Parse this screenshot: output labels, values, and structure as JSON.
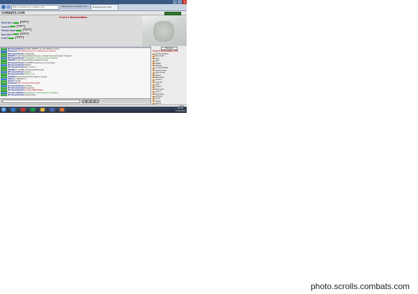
{
  "browser": {
    "address": "http://capitalcity.combats.com/",
    "tabs": [
      "http://www.combats.com",
      "Бойцовский клуб"
    ]
  },
  "game": {
    "logo": "COMBATS.COM",
    "battle_title": "Стуга в Катакомбах",
    "fighters": [
      {
        "name": "Black Eyes",
        "action": "Выйти"
      },
      {
        "name": "Ancient",
        "action": "Выйти"
      },
      {
        "name": "Черная миша",
        "action": "Выйти"
      },
      {
        "name": "Dark Spirit",
        "action": "Выйти"
      },
      {
        "name": "mmmf",
        "action": "Выйти"
      }
    ],
    "chat": [
      {
        "time": "23:21",
        "sender": "[Истинный Воин]",
        "text": "private [ SMARF ] по хил забегаю позже",
        "style": "plain"
      },
      {
        "time": "23:21",
        "sender": "Внимание!",
        "text": "Приведение пресса требование в лечении",
        "style": "red"
      },
      {
        "time": "23:21",
        "sender": "[Истинный Воин]",
        "text": "запомнишь",
        "style": "plain"
      },
      {
        "time": "23:21",
        "sender": "[SMARF]",
        "text": "to [Истинный Воин] Как-раз, а может быть проходит отдельно",
        "style": "plain"
      },
      {
        "time": "23:22",
        "sender": "[Истинный Воин]",
        "text": "Сообщение о продолжении поединка",
        "style": "green"
      },
      {
        "time": "23:22",
        "sender": "[SMARF]",
        "text": "to [Истинный Воин] заходите позже",
        "style": "plain"
      },
      {
        "time": "23:22",
        "sender": "[Истинный Воин]",
        "text": "to [SMARF] я прохожу по лестнице",
        "style": "plain"
      },
      {
        "time": "23:22",
        "sender": "[Истинный Воин]",
        "text": "Привет!",
        "style": "plain"
      },
      {
        "time": "23:23",
        "sender": "[Истинный Воин]",
        "text": "Мы на месте",
        "style": "plain"
      },
      {
        "time": "23:23",
        "sender": "[SMARF]",
        "text": "to [SMARF, Истинный Воин] иду",
        "style": "plain"
      },
      {
        "time": "23:23",
        "sender": "[Истинный Воин]",
        "text": "хорошо",
        "style": "plain"
      },
      {
        "time": "23:24",
        "sender": "[Истинный Воин]",
        "text": "Видим вход",
        "style": "green"
      },
      {
        "time": "23:24",
        "sender": "[SMARF]",
        "text": "to [Истинный Воин] ждите у входа",
        "style": "plain"
      },
      {
        "time": "23:24",
        "sender": "[Istok]",
        "text": "to [SMARF] ок",
        "style": "plain"
      },
      {
        "time": "23:24",
        "sender": "[Istok]",
        "text": "пойдем",
        "style": "plain"
      },
      {
        "time": "23:25",
        "sender": "Внимание!",
        "text": "Вас проводит Black Eyes",
        "style": "red"
      },
      {
        "time": "23:25",
        "sender": "[Истинный Воин]",
        "text": "Спасибо",
        "style": "plain"
      },
      {
        "time": "23:25",
        "sender": "[Истинный Воин]",
        "text": "Вы видите:",
        "style": "plain"
      },
      {
        "time": "23:25",
        "sender": "[Истинный Воин]",
        "text": "private [SMARF] Идём",
        "style": "red"
      },
      {
        "time": "23:26",
        "sender": "[Ancient Wildfire]",
        "text": "Сообщение о продолжении поединка",
        "style": "green"
      },
      {
        "time": "23:26",
        "sender": "[Истинный Воин]",
        "text": "Продолжаем",
        "style": "plain"
      }
    ],
    "roster_button": "Обновить",
    "roster_title": "Стуга в Катакомбах (15)",
    "roster": [
      "Истинный Воин",
      "Black Spirit",
      "Istok",
      "Dark",
      "SMARF",
      "Mistress",
      "Ancient Wildfire",
      "Черная миша",
      "Dark Hunter",
      "Wizard",
      "Black Eyes",
      "Ancient",
      "Cold Fire",
      "Hirek",
      "Alliance",
      "Dark Spirit",
      "mmmf",
      "Black Rose",
      "Northern",
      "Ghost",
      "Leader",
      "Oghrok",
      "Kisel"
    ]
  },
  "status": {
    "zoom": "100%"
  },
  "taskbar": {
    "apps": [
      "Internet Explorer",
      "Opera",
      "Media Player",
      "Folder",
      "Document",
      "Firefox"
    ],
    "time": "23:26",
    "date": "13.04.2011"
  },
  "watermark": "photo.scrolls.combats.com",
  "colors": {
    "accent": "#b00000",
    "chat_sender": "#1a2d8a",
    "taskbar": "#2a3445"
  }
}
